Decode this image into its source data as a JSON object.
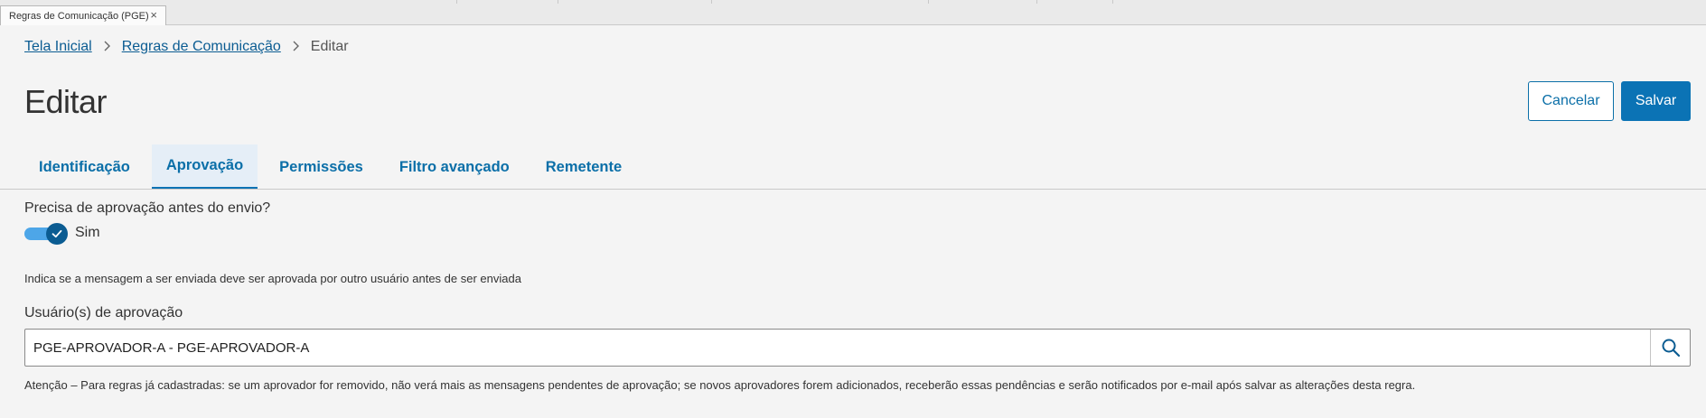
{
  "window_tab": {
    "title": "Regras de Comunicação (PGE)",
    "close": "×"
  },
  "breadcrumb": {
    "home": "Tela Inicial",
    "section": "Regras de Comunicação",
    "current": "Editar"
  },
  "page": {
    "title": "Editar"
  },
  "actions": {
    "cancel": "Cancelar",
    "save": "Salvar"
  },
  "tabs": [
    {
      "label": "Identificação"
    },
    {
      "label": "Aprovação"
    },
    {
      "label": "Permissões"
    },
    {
      "label": "Filtro avançado"
    },
    {
      "label": "Remetente"
    }
  ],
  "approval": {
    "question": "Precisa de aprovação antes do envio?",
    "toggle_state": true,
    "toggle_label": "Sim",
    "help": "Indica se a mensagem a ser enviada deve ser aprovada por outro usuário antes de ser enviada",
    "users_label": "Usuário(s) de aprovação",
    "users_value": "PGE-APROVADOR-A - PGE-APROVADOR-A",
    "note": "Atenção – Para regras já cadastradas: se um aprovador for removido, não verá mais as mensagens pendentes de aprovação; se novos aprovadores forem adicionados, receberão essas pendências e serão notificados por e-mail após salvar as alterações desta regra."
  },
  "colors": {
    "accent": "#0b73b5",
    "link": "#0b5c92",
    "toggle_track": "#4da6e8",
    "tab_active_bg": "#e5eef7"
  },
  "icons": {
    "search": "search-icon",
    "check": "check-icon",
    "chevron": "chevron-right-icon",
    "close": "close-icon"
  }
}
